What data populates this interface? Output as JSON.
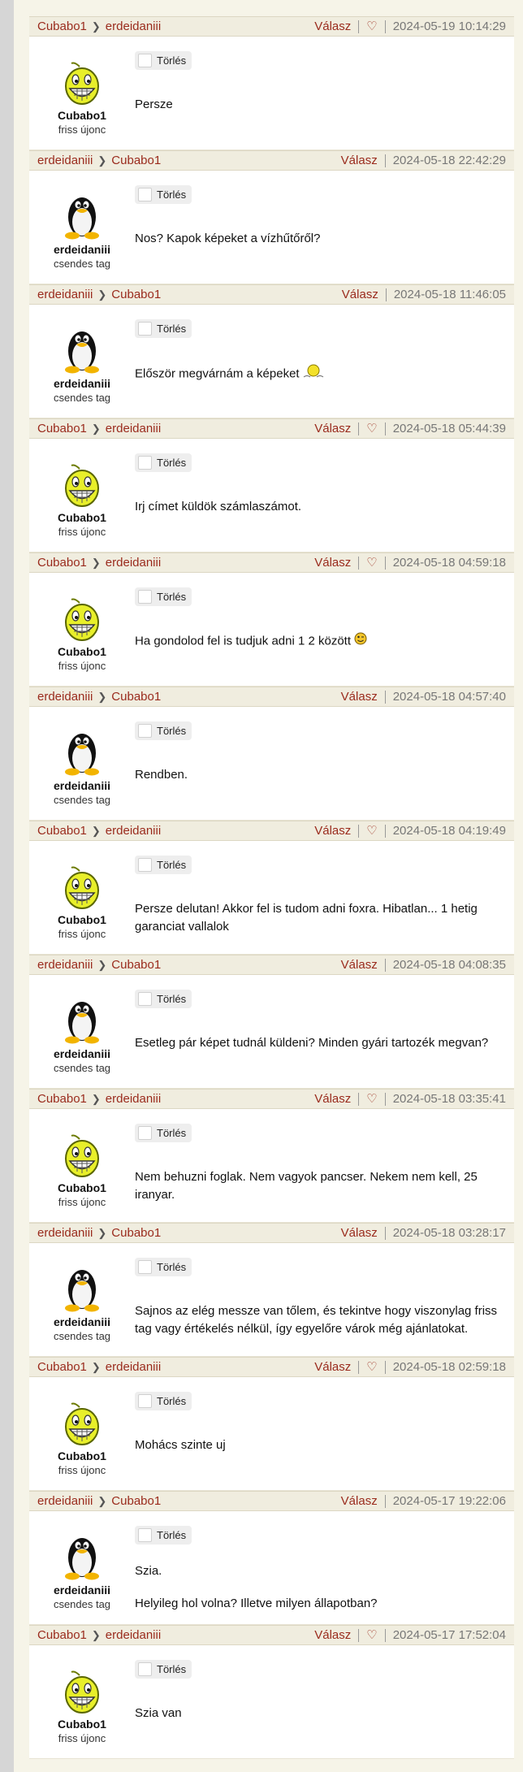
{
  "posts": [
    {
      "from": "Cubabo1",
      "to": "erdeidaniii",
      "reply": "Válasz",
      "heart": true,
      "timestamp": "2024-05-19 10:14:29",
      "author": "Cubabo1",
      "rank": "friss újonc",
      "avatar": "smiley-avatar",
      "delete": "Törlés",
      "lines": [
        "Persze"
      ]
    },
    {
      "from": "erdeidaniii",
      "to": "Cubabo1",
      "reply": "Válasz",
      "heart": false,
      "timestamp": "2024-05-18 22:42:29",
      "author": "erdeidaniii",
      "rank": "csendes tag",
      "avatar": "penguin-avatar",
      "delete": "Törlés",
      "lines": [
        "Nos? Kapok képeket a vízhűtőről?"
      ]
    },
    {
      "from": "erdeidaniii",
      "to": "Cubabo1",
      "reply": "Válasz",
      "heart": false,
      "timestamp": "2024-05-18 11:46:05",
      "author": "erdeidaniii",
      "rank": "csendes tag",
      "avatar": "penguin-avatar",
      "delete": "Törlés",
      "lines": [
        "Először megvárnám a képeket"
      ],
      "emoji": "sleepy-emoji"
    },
    {
      "from": "Cubabo1",
      "to": "erdeidaniii",
      "reply": "Válasz",
      "heart": true,
      "timestamp": "2024-05-18 05:44:39",
      "author": "Cubabo1",
      "rank": "friss újonc",
      "avatar": "smiley-avatar",
      "delete": "Törlés",
      "lines": [
        "Irj címet küldök számlaszámot."
      ]
    },
    {
      "from": "Cubabo1",
      "to": "erdeidaniii",
      "reply": "Válasz",
      "heart": true,
      "timestamp": "2024-05-18 04:59:18",
      "author": "Cubabo1",
      "rank": "friss újonc",
      "avatar": "smiley-avatar",
      "delete": "Törlés",
      "lines": [
        "Ha gondolod fel is tudjuk adni 1 2 között"
      ],
      "emoji": "wink-emoji"
    },
    {
      "from": "erdeidaniii",
      "to": "Cubabo1",
      "reply": "Válasz",
      "heart": false,
      "timestamp": "2024-05-18 04:57:40",
      "author": "erdeidaniii",
      "rank": "csendes tag",
      "avatar": "penguin-avatar",
      "delete": "Törlés",
      "lines": [
        "Rendben."
      ]
    },
    {
      "from": "Cubabo1",
      "to": "erdeidaniii",
      "reply": "Válasz",
      "heart": true,
      "timestamp": "2024-05-18 04:19:49",
      "author": "Cubabo1",
      "rank": "friss újonc",
      "avatar": "smiley-avatar",
      "delete": "Törlés",
      "lines": [
        "Persze delutan! Akkor fel is tudom adni foxra. Hibatlan... 1 hetig garanciat vallalok"
      ]
    },
    {
      "from": "erdeidaniii",
      "to": "Cubabo1",
      "reply": "Válasz",
      "heart": false,
      "timestamp": "2024-05-18 04:08:35",
      "author": "erdeidaniii",
      "rank": "csendes tag",
      "avatar": "penguin-avatar",
      "delete": "Törlés",
      "lines": [
        "Esetleg pár képet tudnál küldeni? Minden gyári tartozék megvan?"
      ]
    },
    {
      "from": "Cubabo1",
      "to": "erdeidaniii",
      "reply": "Válasz",
      "heart": true,
      "timestamp": "2024-05-18 03:35:41",
      "author": "Cubabo1",
      "rank": "friss újonc",
      "avatar": "smiley-avatar",
      "delete": "Törlés",
      "lines": [
        "Nem behuzni foglak. Nem vagyok pancser. Nekem nem kell, 25 iranyar."
      ]
    },
    {
      "from": "erdeidaniii",
      "to": "Cubabo1",
      "reply": "Válasz",
      "heart": false,
      "timestamp": "2024-05-18 03:28:17",
      "author": "erdeidaniii",
      "rank": "csendes tag",
      "avatar": "penguin-avatar",
      "delete": "Törlés",
      "lines": [
        "Sajnos az elég messze van tőlem, és tekintve hogy viszonylag friss tag vagy értékelés nélkül, így egyelőre várok még ajánlatokat."
      ]
    },
    {
      "from": "Cubabo1",
      "to": "erdeidaniii",
      "reply": "Válasz",
      "heart": true,
      "timestamp": "2024-05-18 02:59:18",
      "author": "Cubabo1",
      "rank": "friss újonc",
      "avatar": "smiley-avatar",
      "delete": "Törlés",
      "lines": [
        "Mohács szinte uj"
      ]
    },
    {
      "from": "erdeidaniii",
      "to": "Cubabo1",
      "reply": "Válasz",
      "heart": false,
      "timestamp": "2024-05-17 19:22:06",
      "author": "erdeidaniii",
      "rank": "csendes tag",
      "avatar": "penguin-avatar",
      "delete": "Törlés",
      "lines": [
        "Szia.",
        "Helyileg hol volna? Illetve milyen állapotban?"
      ]
    },
    {
      "from": "Cubabo1",
      "to": "erdeidaniii",
      "reply": "Válasz",
      "heart": true,
      "timestamp": "2024-05-17 17:52:04",
      "author": "Cubabo1",
      "rank": "friss újonc",
      "avatar": "smiley-avatar",
      "delete": "Törlés",
      "lines": [
        "Szia van"
      ]
    }
  ],
  "colors": {
    "link": "#9a2b1d",
    "header_bg": "#f0eddf",
    "page_bg": "#f6f4e8",
    "card_bg": "#ffffff",
    "timestamp": "#777777"
  }
}
